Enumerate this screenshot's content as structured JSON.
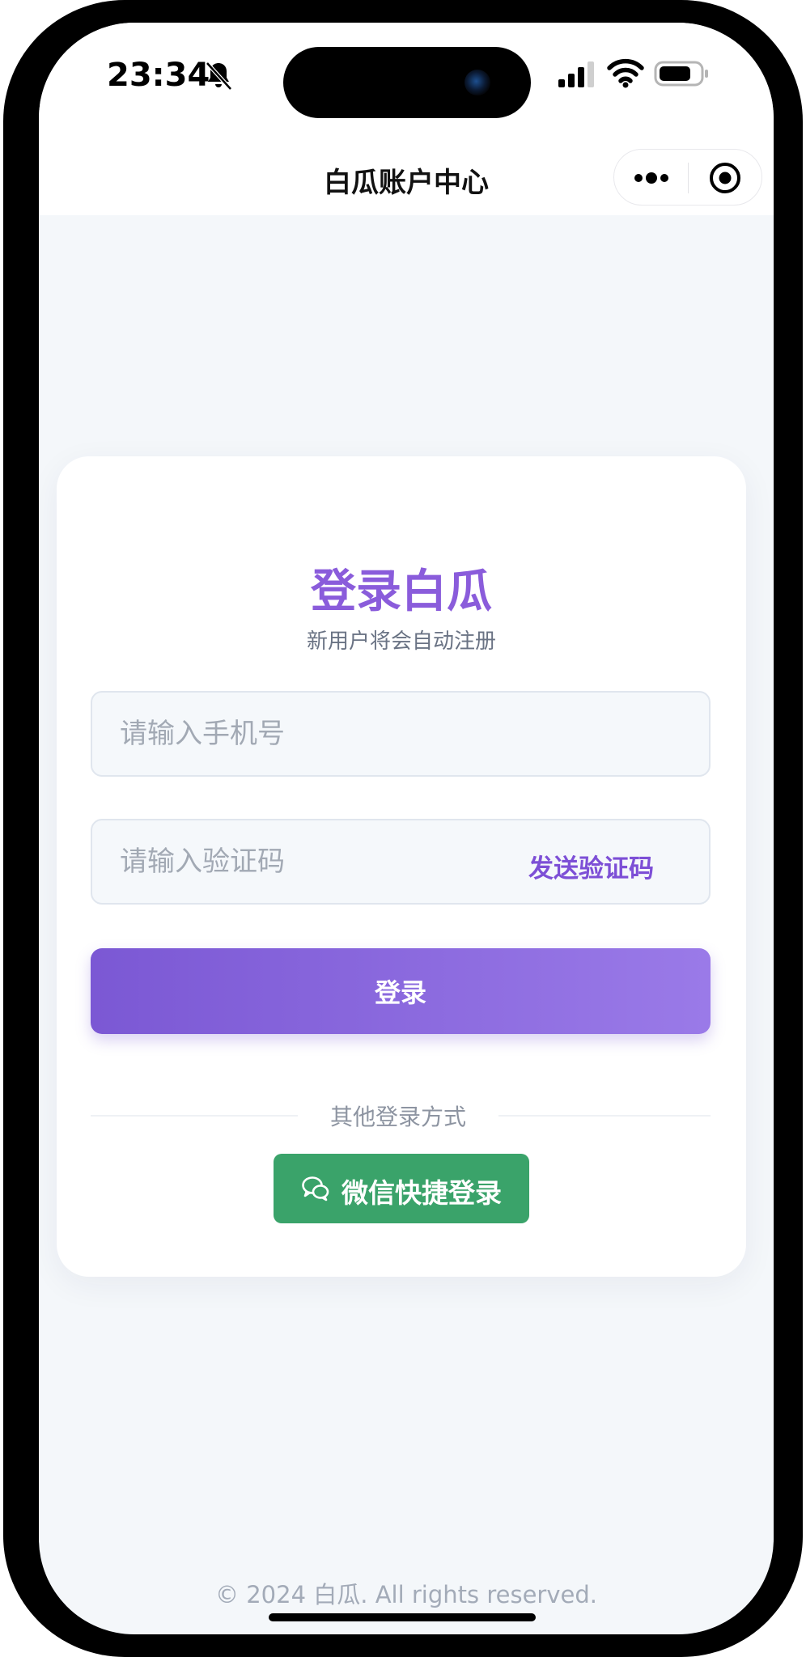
{
  "status_bar": {
    "time": "23:34",
    "icons": [
      "bell-slash-icon",
      "cellular-signal-icon",
      "wifi-icon",
      "battery-icon"
    ]
  },
  "nav": {
    "title": "白瓜账户中心",
    "capsule_icons": [
      "more-icon",
      "close-target-icon"
    ]
  },
  "login": {
    "title": "登录白瓜",
    "subtitle": "新用户将会自动注册",
    "phone_placeholder": "请输入手机号",
    "phone_value": "",
    "code_placeholder": "请输入验证码",
    "code_value": "",
    "send_code_label": "发送验证码",
    "submit_label": "登录",
    "other_methods_label": "其他登录方式",
    "wechat_label": "微信快捷登录"
  },
  "footer": {
    "copyright": "© 2024 白瓜. All rights reserved."
  },
  "colors": {
    "accent_purple": "#7d4fd6",
    "button_gradient_start": "#7b58d4",
    "button_gradient_end": "#9a7ae8",
    "wechat_green": "#3aa36a",
    "page_background": "#f4f7fa"
  }
}
